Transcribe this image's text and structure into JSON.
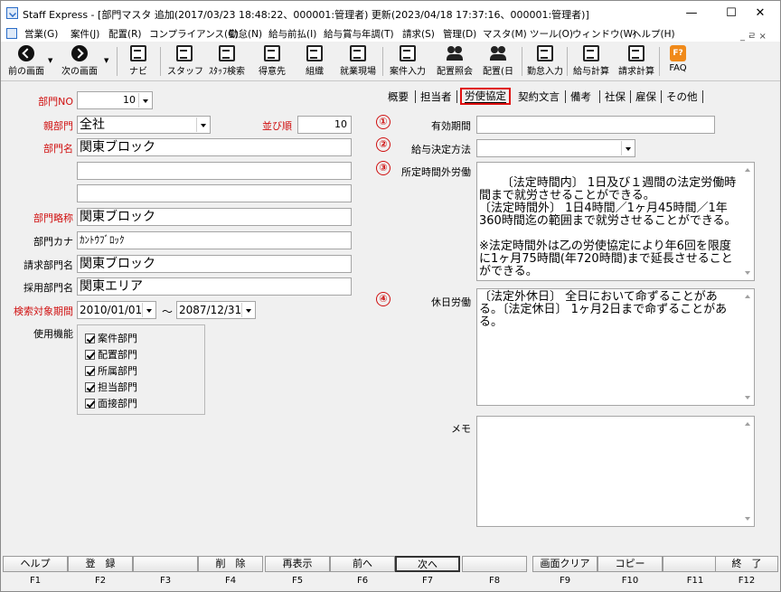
{
  "window": {
    "title": "Staff Express - [部門マスタ 追加(2017/03/23 18:48:22、000001:管理者) 更新(2023/04/18 17:37:16、000001:管理者)]",
    "minimize": "—",
    "maximize": "☐",
    "close": "✕"
  },
  "menu": [
    "営業(G)",
    "案件(J)",
    "配置(R)",
    "コンプライアンス(C)",
    "勤怠(N)",
    "給与前払(I)",
    "給与賞与年調(T)",
    "請求(S)",
    "管理(D)",
    "マスタ(M)",
    "ツール(O)",
    "ウィンドウ(W)",
    "ヘルプ(H)"
  ],
  "mdi_controls": "_ ㄹ ×",
  "toolbar": [
    "前の画面",
    "次の画面",
    "ナビ",
    "スタッフ",
    "ｽﾀｯﾌ検索",
    "得意先",
    "組織",
    "就業現場",
    "案件入力",
    "配置照会",
    "配置(日",
    "勤怠入力",
    "給与計算",
    "請求計算",
    "FAQ"
  ],
  "left": {
    "dept_no_label": "部門NO",
    "dept_no": "10",
    "parent_label": "親部門",
    "parent": "全社",
    "order_label": "並び順",
    "order": "10",
    "name_label": "部門名",
    "name": "関東ブロック",
    "name2": "",
    "name3": "",
    "abbr_label": "部門略称",
    "abbr": "関東ブロック",
    "kana_label": "部門カナ",
    "kana": "ｶﾝﾄｳﾌﾞﾛｯｸ",
    "billing_label": "請求部門名",
    "billing": "関東ブロック",
    "hiring_label": "採用部門名",
    "hiring": "関東エリア",
    "period_label": "検索対象期間",
    "period_from": "2010/01/01",
    "period_sep": "～",
    "period_to": "2087/12/31",
    "usage_label": "使用機能",
    "usage": [
      "案件部門",
      "配置部門",
      "所属部門",
      "担当部門",
      "面接部門"
    ]
  },
  "tabs": [
    "概要",
    "担当者",
    "労使協定",
    "契約文言",
    "備考",
    "社保",
    "雇保",
    "その他"
  ],
  "right": {
    "mark1": "①",
    "mark2": "②",
    "mark3": "③",
    "mark4": "④",
    "valid_label": "有効期間",
    "valid": "",
    "payment_label": "給与決定方法",
    "payment": "",
    "overtime_label": "所定時間外労働",
    "overtime_text": "〔法定時間内〕 1日及び１週間の法定労働時間まで就労させることができる。\n〔法定時間外〕 1日4時間／1ヶ月45時間／1年360時間迄の範囲まで就労させることができる。\n\n※法定時間外は乙の労使協定により年6回を限度に1ヶ月75時間(年720時間)まで延長させることができる。",
    "holiday_label": "休日労働",
    "holiday_text": "〔法定外休日〕 全日において命ずることがある。〔法定休日〕 1ヶ月2日まで命ずることがある。",
    "memo_label": "メモ",
    "memo": ""
  },
  "fkeys": [
    {
      "label": "ヘルプ",
      "key": "F1"
    },
    {
      "label": "登　録",
      "key": "F2"
    },
    {
      "label": "",
      "key": "F3"
    },
    {
      "label": "削　除",
      "key": "F4"
    },
    {
      "label": "再表示",
      "key": "F5"
    },
    {
      "label": "前へ",
      "key": "F6"
    },
    {
      "label": "次へ",
      "key": "F7"
    },
    {
      "label": "",
      "key": "F8"
    },
    {
      "label": "画面クリア",
      "key": "F9"
    },
    {
      "label": "コピー",
      "key": "F10"
    },
    {
      "label": "",
      "key": "F11"
    },
    {
      "label": "終　了",
      "key": "F12"
    }
  ],
  "colors": {
    "accent_red": "#d01010",
    "tab_highlight": "#e01010"
  }
}
